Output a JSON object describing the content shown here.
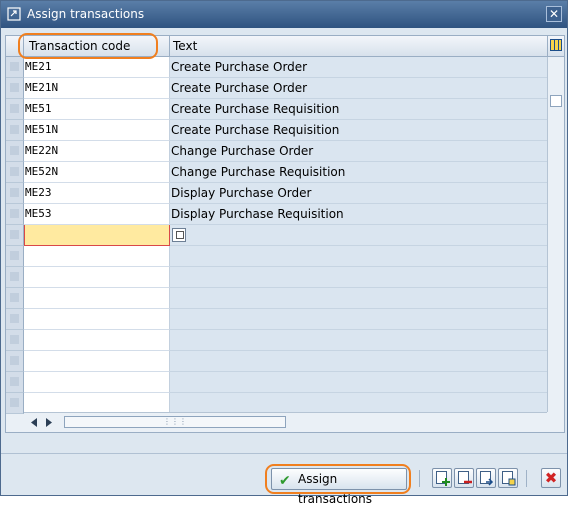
{
  "window": {
    "title": "Assign transactions",
    "close_glyph": "✕"
  },
  "table": {
    "columns": {
      "code": "Transaction code",
      "text": "Text"
    },
    "rows": [
      {
        "code": "ME21",
        "text": "Create Purchase Order"
      },
      {
        "code": "ME21N",
        "text": "Create Purchase Order"
      },
      {
        "code": "ME51",
        "text": "Create Purchase Requisition"
      },
      {
        "code": "ME51N",
        "text": "Create Purchase Requisition"
      },
      {
        "code": "ME22N",
        "text": "Change Purchase Order"
      },
      {
        "code": "ME52N",
        "text": "Change Purchase Requisition"
      },
      {
        "code": "ME23",
        "text": "Display Purchase Order"
      },
      {
        "code": "ME53",
        "text": "Display Purchase Requisition"
      }
    ],
    "empty_rows": 8
  },
  "footer": {
    "assign_label": "Assign transactions",
    "icons": [
      "append-row-icon",
      "delete-row-icon",
      "insert-row-icon",
      "copy-row-icon",
      "cancel-icon"
    ]
  },
  "colors": {
    "highlight": "#f07f1f",
    "title_bar": "#2f5380",
    "input_active": "#ffeaa0"
  }
}
